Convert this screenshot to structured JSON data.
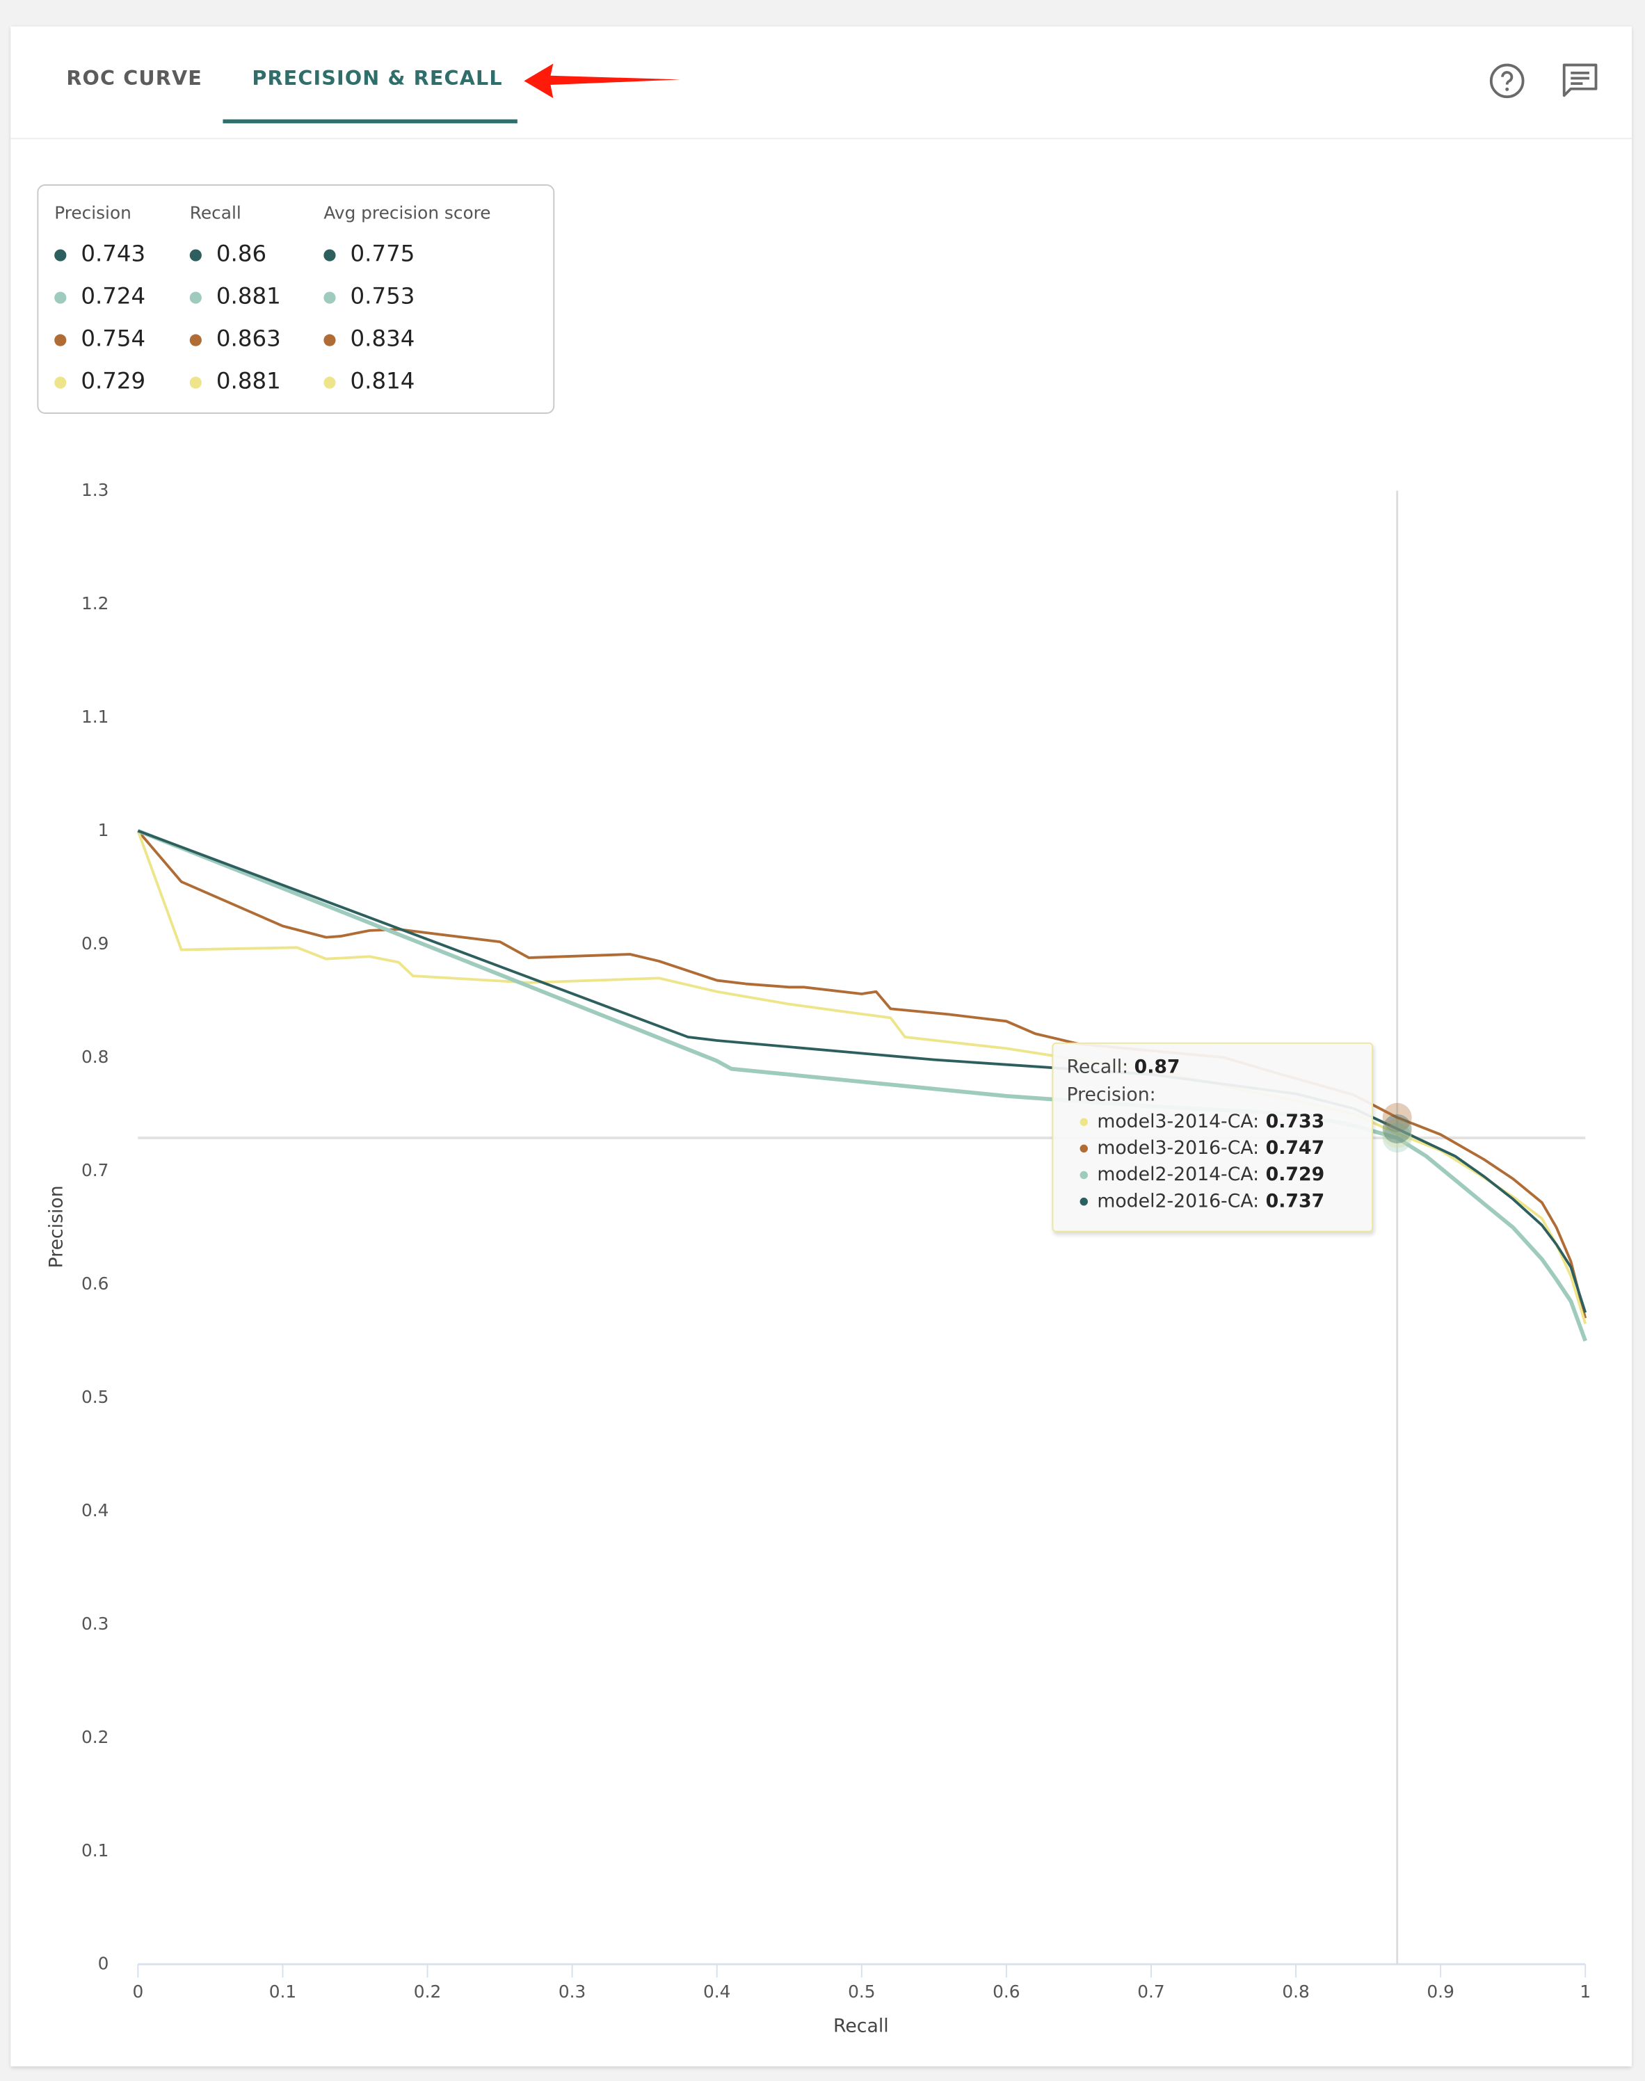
{
  "tabs": [
    {
      "label": "ROC CURVE",
      "active": false
    },
    {
      "label": "PRECISION & RECALL",
      "active": true
    }
  ],
  "toolbar": {
    "help_icon": "help-circle-icon",
    "comment_icon": "comment-icon"
  },
  "annotation": {
    "arrow_color": "#ff1a0a"
  },
  "colors": {
    "model2_2016": "#2e5f5f",
    "model2_2014": "#9ecbbd",
    "model3_2016": "#b06c35",
    "model3_2014": "#eee58a",
    "accent": "#2f6e6a"
  },
  "legend": {
    "headers": [
      "Precision",
      "Recall",
      "Avg precision score"
    ],
    "rows": [
      {
        "color": "#2e5f5f",
        "precision": "0.743",
        "recall": "0.86",
        "avg_precision": "0.775"
      },
      {
        "color": "#9ecbbd",
        "precision": "0.724",
        "recall": "0.881",
        "avg_precision": "0.753"
      },
      {
        "color": "#b06c35",
        "precision": "0.754",
        "recall": "0.863",
        "avg_precision": "0.834"
      },
      {
        "color": "#eee58a",
        "precision": "0.729",
        "recall": "0.881",
        "avg_precision": "0.814"
      }
    ]
  },
  "tooltip": {
    "recall_label": "Recall:",
    "recall_value": "0.87",
    "precision_label": "Precision:",
    "items": [
      {
        "name": "model3-2014-CA:",
        "value": "0.733",
        "color": "#eee58a"
      },
      {
        "name": "model3-2016-CA:",
        "value": "0.747",
        "color": "#b06c35"
      },
      {
        "name": "model2-2014-CA:",
        "value": "0.729",
        "color": "#9ecbbd"
      },
      {
        "name": "model2-2016-CA:",
        "value": "0.737",
        "color": "#2e5f5f"
      }
    ]
  },
  "chart_data": {
    "type": "line",
    "title": "",
    "xlabel": "Recall",
    "ylabel": "Precision",
    "xlim": [
      0,
      1
    ],
    "ylim": [
      0,
      1.3
    ],
    "xticks": [
      "0",
      "0.1",
      "0.2",
      "0.3",
      "0.4",
      "0.5",
      "0.6",
      "0.7",
      "0.8",
      "0.9",
      "1"
    ],
    "yticks": [
      "0",
      "0.1",
      "0.2",
      "0.3",
      "0.4",
      "0.5",
      "0.6",
      "0.7",
      "0.8",
      "0.9",
      "1",
      "1.1",
      "1.2",
      "1.3"
    ],
    "grid": false,
    "crosshair": {
      "x": 0.87,
      "y": 0.729
    },
    "series": [
      {
        "name": "model3-2014-CA",
        "color": "#eee58a",
        "x": [
          0,
          0.03,
          0.11,
          0.13,
          0.16,
          0.18,
          0.19,
          0.27,
          0.36,
          0.4,
          0.45,
          0.49,
          0.52,
          0.53,
          0.6,
          0.66,
          0.72,
          0.76,
          0.8,
          0.84,
          0.87,
          0.9,
          0.93,
          0.95,
          0.97,
          0.98,
          0.99,
          1.0
        ],
        "y": [
          1.0,
          0.895,
          0.897,
          0.887,
          0.889,
          0.884,
          0.872,
          0.866,
          0.87,
          0.858,
          0.847,
          0.84,
          0.835,
          0.818,
          0.808,
          0.796,
          0.784,
          0.772,
          0.762,
          0.75,
          0.733,
          0.718,
          0.694,
          0.677,
          0.658,
          0.635,
          0.607,
          0.565
        ]
      },
      {
        "name": "model3-2016-CA",
        "color": "#b06c35",
        "x": [
          0,
          0.03,
          0.1,
          0.13,
          0.14,
          0.16,
          0.18,
          0.25,
          0.27,
          0.34,
          0.36,
          0.4,
          0.42,
          0.45,
          0.46,
          0.5,
          0.51,
          0.52,
          0.56,
          0.6,
          0.62,
          0.65,
          0.7,
          0.75,
          0.79,
          0.84,
          0.87,
          0.9,
          0.93,
          0.95,
          0.97,
          0.98,
          0.99,
          1.0
        ],
        "y": [
          1.0,
          0.955,
          0.916,
          0.906,
          0.907,
          0.912,
          0.913,
          0.902,
          0.888,
          0.891,
          0.885,
          0.868,
          0.865,
          0.862,
          0.862,
          0.856,
          0.858,
          0.843,
          0.838,
          0.832,
          0.821,
          0.812,
          0.806,
          0.8,
          0.785,
          0.767,
          0.747,
          0.732,
          0.71,
          0.693,
          0.672,
          0.65,
          0.62,
          0.57
        ]
      },
      {
        "name": "model2-2014-CA",
        "color": "#9ecbbd",
        "x": [
          0,
          0.4,
          0.41,
          0.6,
          0.7,
          0.8,
          0.84,
          0.87,
          0.89,
          0.91,
          0.93,
          0.95,
          0.97,
          0.98,
          0.99,
          1.0
        ],
        "y": [
          1.0,
          0.797,
          0.79,
          0.766,
          0.757,
          0.75,
          0.74,
          0.729,
          0.713,
          0.692,
          0.671,
          0.65,
          0.622,
          0.604,
          0.585,
          0.55
        ]
      },
      {
        "name": "model2-2016-CA",
        "color": "#2e5f5f",
        "x": [
          0,
          0.38,
          0.4,
          0.55,
          0.7,
          0.8,
          0.84,
          0.87,
          0.89,
          0.91,
          0.93,
          0.95,
          0.97,
          0.98,
          0.99,
          1.0
        ],
        "y": [
          1.0,
          0.818,
          0.815,
          0.798,
          0.785,
          0.768,
          0.755,
          0.737,
          0.725,
          0.713,
          0.695,
          0.675,
          0.652,
          0.635,
          0.615,
          0.575
        ]
      }
    ]
  }
}
